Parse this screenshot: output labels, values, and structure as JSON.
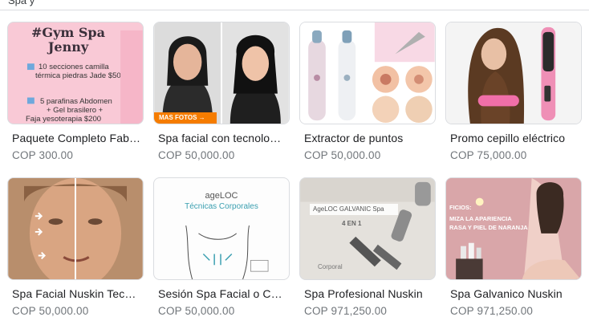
{
  "header": {
    "cut_text": "Spa y"
  },
  "products": [
    {
      "title": "Paquete Completo Fab…",
      "price": "COP 300.00",
      "image": {
        "heading_line1": "#Gym Spa",
        "heading_line2": "Jenny",
        "line1": "10 secciones camilla",
        "line2": "térmica piedras Jade $50",
        "line3": "5 parafinas Abdomen",
        "line4": "+ Gel brasilero +",
        "line5": "Faja yesoterapia  $200"
      }
    },
    {
      "title": "Spa facial con tecnolo…",
      "price": "COP 50,000.00",
      "image": {
        "badge": "MAS FOTOS  →"
      }
    },
    {
      "title": "Extractor de puntos",
      "price": "COP 50,000.00",
      "image": {}
    },
    {
      "title": "Promo cepillo eléctrico",
      "price": "COP 75,000.00",
      "image": {}
    },
    {
      "title": "Spa Facial Nuskin Tec…",
      "price": "COP 50,000.00",
      "image": {}
    },
    {
      "title": "Sesión Spa Facial o C…",
      "price": "COP 50,000.00",
      "image": {
        "logo": "ageLOC",
        "subtitle": "Técnicas Corporales"
      }
    },
    {
      "title": "Spa Profesional Nuskin",
      "price": "COP 971,250.00",
      "image": {
        "badge": "AgeLOC GALVANIC Spa",
        "sub": "4 EN 1",
        "caption": "Corporal"
      }
    },
    {
      "title": "Spa Galvanico Nuskin",
      "price": "COP 971,250.00",
      "image": {
        "line1": "FICIOS:",
        "line2": "MIZA LA APARIENCIA",
        "line3": "RASA Y PIEL DE NARANJA"
      }
    }
  ],
  "colors": {
    "border": "#dadce0",
    "title_text": "#202124",
    "price_text": "#70757a",
    "pink_bg": "#f7c6d3",
    "orange_badge": "#f57c00"
  }
}
